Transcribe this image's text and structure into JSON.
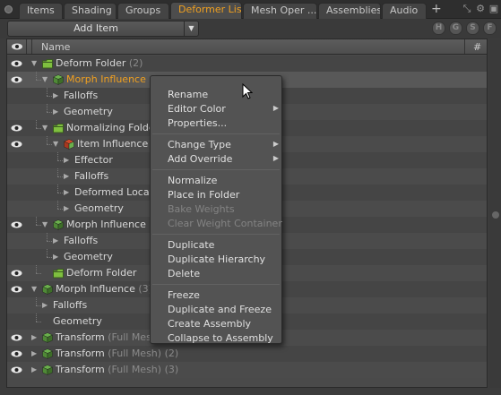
{
  "tabs": [
    {
      "label": "Items"
    },
    {
      "label": "Shading"
    },
    {
      "label": "Groups"
    },
    {
      "label": "Deformer List"
    },
    {
      "label": "Mesh Oper ..."
    },
    {
      "label": "Assemblies"
    },
    {
      "label": "Audio"
    }
  ],
  "tabbar": {
    "plus": "+",
    "active": "Deformer List"
  },
  "toolbar": {
    "add_item": "Add Item",
    "filters": [
      "H",
      "G",
      "S",
      "F"
    ]
  },
  "list": {
    "header_name": "Name",
    "header_hash": "#",
    "rows": [
      {
        "name": "Deform Folder",
        "suffix": "(2)",
        "icon": "folder-icon"
      },
      {
        "name": "Morph Influence",
        "suffix": "",
        "icon": "morph-cube-icon",
        "selected": true
      },
      {
        "name": "Falloffs",
        "suffix": "",
        "icon": ""
      },
      {
        "name": "Geometry",
        "suffix": "",
        "icon": ""
      },
      {
        "name": "Normalizing Folde",
        "suffix": "",
        "icon": "folder-icon"
      },
      {
        "name": "Item Influence",
        "suffix": "",
        "icon": "item-influence-cube-icon"
      },
      {
        "name": "Effector",
        "suffix": "",
        "icon": ""
      },
      {
        "name": "Falloffs",
        "suffix": "",
        "icon": ""
      },
      {
        "name": "Deformed Locat",
        "suffix": "",
        "icon": ""
      },
      {
        "name": "Geometry",
        "suffix": "",
        "icon": ""
      },
      {
        "name": "Morph Influence",
        "suffix": "",
        "icon": "morph-cube-icon"
      },
      {
        "name": "Falloffs",
        "suffix": "",
        "icon": ""
      },
      {
        "name": "Geometry",
        "suffix": "",
        "icon": ""
      },
      {
        "name": "Deform Folder",
        "suffix": "",
        "icon": "folder-icon"
      },
      {
        "name": "Morph Influence",
        "suffix": "(3)",
        "icon": "morph-cube-icon"
      },
      {
        "name": "Falloffs",
        "suffix": "",
        "icon": ""
      },
      {
        "name": "Geometry",
        "suffix": "",
        "icon": ""
      },
      {
        "name": "Transform",
        "suffix": "(Full Mesh)",
        "icon": "transform-cube-icon"
      },
      {
        "name": "Transform",
        "suffix": "(Full Mesh) (2)",
        "icon": "transform-cube-icon"
      },
      {
        "name": "Transform",
        "suffix": "(Full Mesh) (3)",
        "icon": "transform-cube-icon"
      }
    ]
  },
  "context_menu": {
    "items": [
      {
        "label": "Rename",
        "submenu": false,
        "disabled": false
      },
      {
        "label": "Editor Color",
        "submenu": true,
        "disabled": false
      },
      {
        "label": "Properties...",
        "submenu": false,
        "disabled": false
      },
      {
        "label": "Change Type",
        "submenu": true,
        "disabled": false
      },
      {
        "label": "Add Override",
        "submenu": true,
        "disabled": false
      },
      {
        "label": "Normalize",
        "submenu": false,
        "disabled": false
      },
      {
        "label": "Place in Folder",
        "submenu": false,
        "disabled": false
      },
      {
        "label": "Bake Weights",
        "submenu": false,
        "disabled": true
      },
      {
        "label": "Clear Weight Container",
        "submenu": false,
        "disabled": true
      },
      {
        "label": "Duplicate",
        "submenu": false,
        "disabled": false
      },
      {
        "label": "Duplicate Hierarchy",
        "submenu": false,
        "disabled": false
      },
      {
        "label": "Delete",
        "submenu": false,
        "disabled": false
      },
      {
        "label": "Freeze",
        "submenu": false,
        "disabled": false
      },
      {
        "label": "Duplicate and Freeze",
        "submenu": false,
        "disabled": false
      },
      {
        "label": "Create Assembly",
        "submenu": false,
        "disabled": false
      },
      {
        "label": "Collapse to Assembly",
        "submenu": false,
        "disabled": false
      }
    ]
  },
  "colors": {
    "accent": "#f0a020",
    "folder": "#7fbf3f",
    "cube_green": "#6ab04c",
    "cube_red": "#d04a2a"
  }
}
